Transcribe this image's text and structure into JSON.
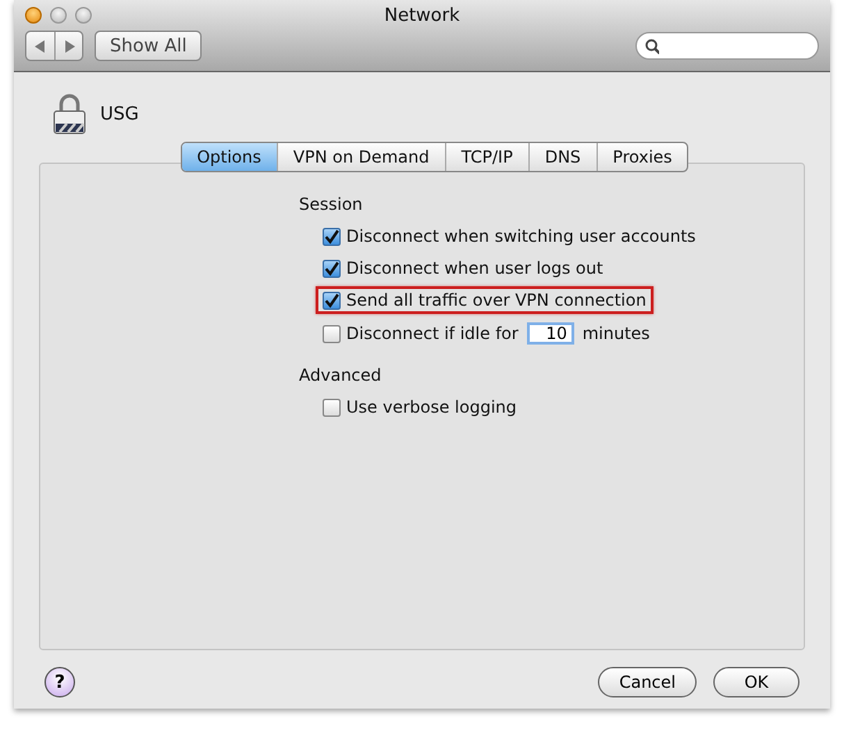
{
  "window": {
    "title": "Network"
  },
  "toolbar": {
    "show_all": "Show All"
  },
  "service": {
    "name": "USG"
  },
  "tabs": [
    {
      "label": "Options",
      "selected": true
    },
    {
      "label": "VPN on Demand",
      "selected": false
    },
    {
      "label": "TCP/IP",
      "selected": false
    },
    {
      "label": "DNS",
      "selected": false
    },
    {
      "label": "Proxies",
      "selected": false
    }
  ],
  "sections": [
    {
      "title": "Session",
      "options": [
        {
          "kind": "checkbox",
          "label": "Disconnect when switching user accounts",
          "checked": true,
          "highlighted": false
        },
        {
          "kind": "checkbox",
          "label": "Disconnect when user logs out",
          "checked": true,
          "highlighted": false
        },
        {
          "kind": "checkbox",
          "label": "Send all traffic over VPN connection",
          "checked": true,
          "highlighted": true
        },
        {
          "kind": "idle",
          "label": "Disconnect if idle for",
          "checked": false,
          "highlighted": false,
          "value": "10",
          "suffix": "minutes"
        }
      ]
    },
    {
      "title": "Advanced",
      "options": [
        {
          "kind": "checkbox",
          "label": "Use verbose logging",
          "checked": false,
          "highlighted": false
        }
      ]
    }
  ],
  "buttons": {
    "help": "?",
    "cancel": "Cancel",
    "ok": "OK"
  }
}
